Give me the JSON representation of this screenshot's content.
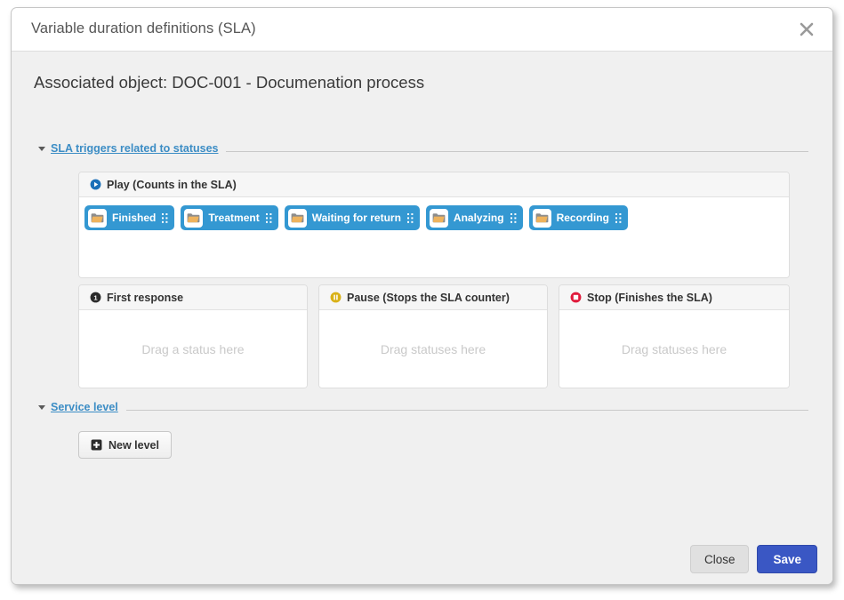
{
  "dialog": {
    "title": "Variable duration definitions (SLA)",
    "close_icon": "close-icon",
    "associated_object": "Associated object: DOC-001 - Documenation process"
  },
  "sections": [
    {
      "label": "SLA triggers related to statuses",
      "caret_icon": "caret-down-icon"
    },
    {
      "label": "Service level",
      "caret_icon": "caret-down-icon"
    }
  ],
  "play_panel": {
    "icon": "play-circle-icon",
    "icon_color": "#1a70b8",
    "label": "Play (Counts in the SLA)",
    "chips": [
      {
        "label": "Finished",
        "folder_icon": "folder-icon",
        "grip_icon": "drag-handle-icon"
      },
      {
        "label": "Treatment",
        "folder_icon": "folder-icon",
        "grip_icon": "drag-handle-icon"
      },
      {
        "label": "Waiting for return",
        "folder_icon": "folder-icon",
        "grip_icon": "drag-handle-icon"
      },
      {
        "label": "Analyzing",
        "folder_icon": "folder-icon",
        "grip_icon": "drag-handle-icon"
      },
      {
        "label": "Recording",
        "folder_icon": "folder-icon",
        "grip_icon": "drag-handle-icon"
      }
    ],
    "chip_color": "#3498d2"
  },
  "trigger_panels": [
    {
      "icon": "number-one-circle-icon",
      "icon_color": "#2b2b2b",
      "label": "First response",
      "placeholder": "Drag a status here"
    },
    {
      "icon": "pause-circle-icon",
      "icon_color": "#d9b117",
      "label": "Pause (Stops the SLA counter)",
      "placeholder": "Drag statuses here"
    },
    {
      "icon": "stop-circle-icon",
      "icon_color": "#e01b3c",
      "label": "Stop (Finishes the SLA)",
      "placeholder": "Drag statuses here"
    }
  ],
  "service_level": {
    "new_level_label": "New level",
    "new_level_icon": "plus-square-icon"
  },
  "footer": {
    "close_label": "Close",
    "save_label": "Save",
    "save_color": "#3a57c4"
  }
}
